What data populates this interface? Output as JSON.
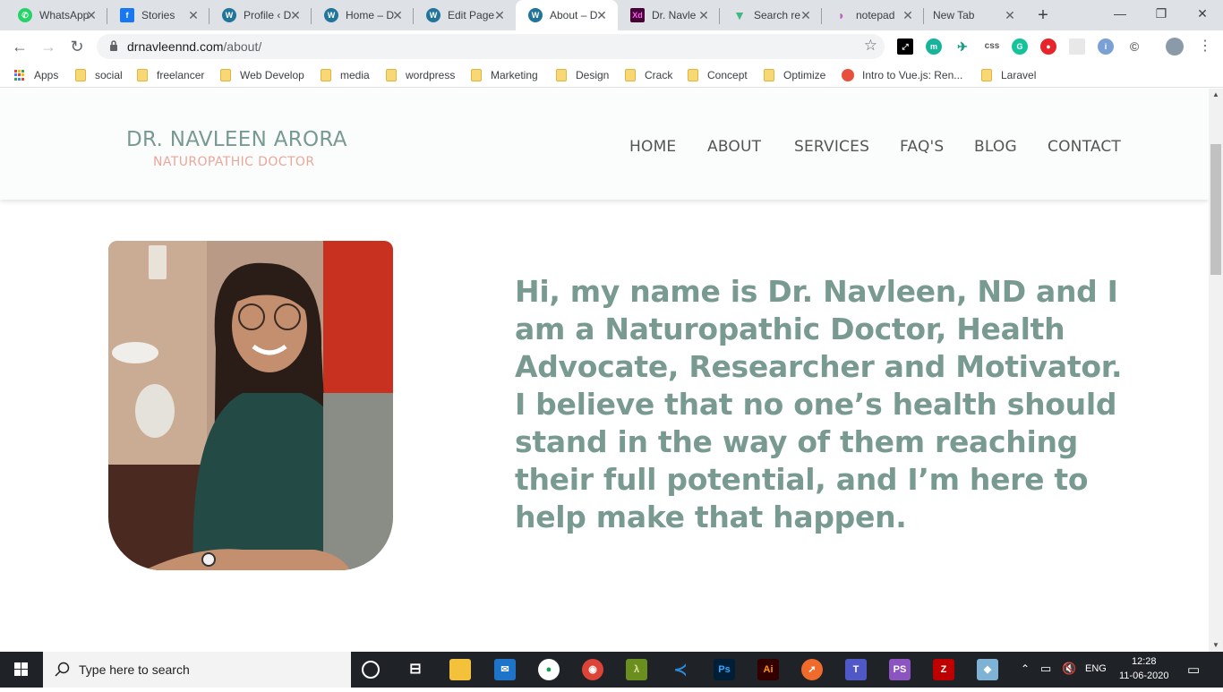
{
  "browser": {
    "tabs": [
      {
        "title": "WhatsApp",
        "icon": "whatsapp-icon",
        "color": "#25d366"
      },
      {
        "title": "Stories",
        "icon": "facebook-icon",
        "color": "#1877f2"
      },
      {
        "title": "Profile ‹ D",
        "icon": "wordpress-icon",
        "color": "#21759b"
      },
      {
        "title": "Home – D",
        "icon": "wordpress-icon",
        "color": "#21759b"
      },
      {
        "title": "Edit Page",
        "icon": "wordpress-icon",
        "color": "#21759b"
      },
      {
        "title": "About – D",
        "icon": "wordpress-icon",
        "color": "#21759b",
        "active": true
      },
      {
        "title": "Dr. Navle",
        "icon": "adobe-xd-icon",
        "color": "#470137"
      },
      {
        "title": "Search re",
        "icon": "vue-icon",
        "color": "#41b883"
      },
      {
        "title": "notepad",
        "icon": "notepad-icon",
        "color": "#c060c0"
      },
      {
        "title": "New Tab",
        "icon": "",
        "color": ""
      }
    ],
    "url_host": "drnavleennd.com",
    "url_path": "/about/",
    "bookmarks": [
      {
        "label": "Apps"
      },
      {
        "label": "social"
      },
      {
        "label": "freelancer"
      },
      {
        "label": "Web Develop"
      },
      {
        "label": "media"
      },
      {
        "label": "wordpress"
      },
      {
        "label": "Marketing"
      },
      {
        "label": "Design"
      },
      {
        "label": "Crack"
      },
      {
        "label": "Concept"
      },
      {
        "label": "Optimize"
      },
      {
        "label": "Intro to Vue.js: Ren..."
      },
      {
        "label": "Laravel"
      }
    ],
    "extension_css_label": "css"
  },
  "site": {
    "brand_name": "DR. NAVLEEN ARORA",
    "brand_tagline": "NATUROPATHIC DOCTOR",
    "nav": [
      "HOME",
      "ABOUT",
      "SERVICES",
      "FAQ'S",
      "BLOG",
      "CONTACT"
    ],
    "intro_text": "Hi, my name is Dr. Navleen, ND and I am a Naturopathic Doctor, Health Advocate, Researcher and Motivator. I believe that no one’s health should stand in the way of them reaching their full potential, and I’m here to help make that happen.",
    "brand_color": "#789a91",
    "accent_color": "#e8a79a"
  },
  "taskbar": {
    "search_placeholder": "Type here to search",
    "language": "ENG",
    "time": "12:28",
    "date": "11-06-2020"
  }
}
